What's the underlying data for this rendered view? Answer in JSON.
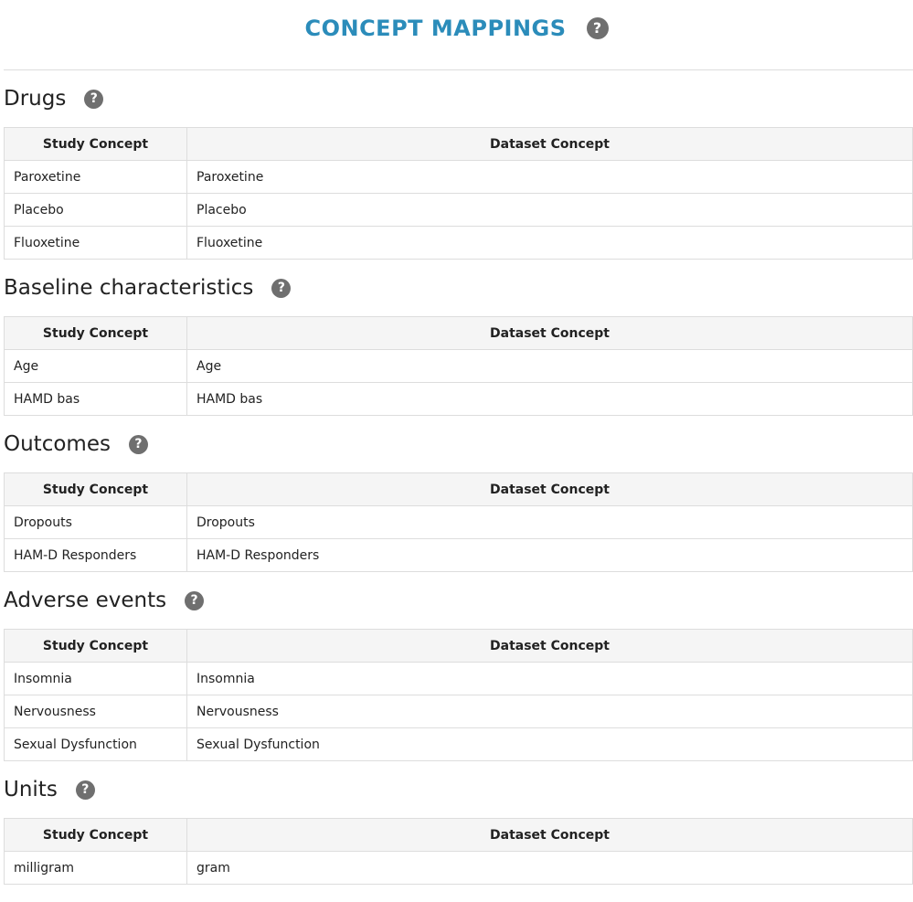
{
  "page": {
    "title": "CONCEPT MAPPINGS",
    "help_glyph": "?",
    "accent_color": "#2b8cba"
  },
  "columns": {
    "study": "Study Concept",
    "dataset": "Dataset Concept"
  },
  "sections": [
    {
      "title": "Drugs",
      "rows": [
        {
          "study": "Paroxetine",
          "dataset": "Paroxetine"
        },
        {
          "study": "Placebo",
          "dataset": "Placebo"
        },
        {
          "study": "Fluoxetine",
          "dataset": "Fluoxetine"
        }
      ]
    },
    {
      "title": "Baseline characteristics",
      "rows": [
        {
          "study": "Age",
          "dataset": "Age"
        },
        {
          "study": "HAMD bas",
          "dataset": "HAMD bas"
        }
      ]
    },
    {
      "title": "Outcomes",
      "rows": [
        {
          "study": "Dropouts",
          "dataset": "Dropouts"
        },
        {
          "study": "HAM-D Responders",
          "dataset": "HAM-D Responders"
        }
      ]
    },
    {
      "title": "Adverse events",
      "rows": [
        {
          "study": "Insomnia",
          "dataset": "Insomnia"
        },
        {
          "study": "Nervousness",
          "dataset": "Nervousness"
        },
        {
          "study": "Sexual Dysfunction",
          "dataset": "Sexual Dysfunction"
        }
      ]
    },
    {
      "title": "Units",
      "rows": [
        {
          "study": "milligram",
          "dataset": "gram"
        }
      ]
    }
  ]
}
